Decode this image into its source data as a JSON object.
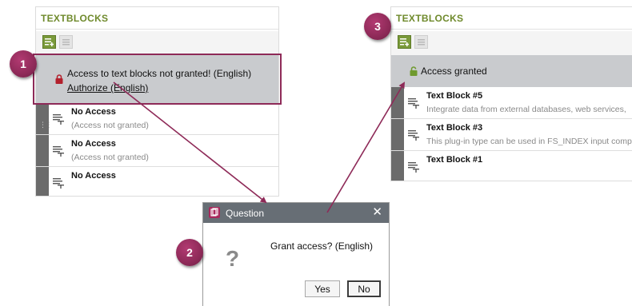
{
  "left_panel": {
    "title": "TEXTBLOCKS",
    "notice_text": "Access to text blocks not granted! (English)",
    "notice_link": "Authorize (English)",
    "items": [
      {
        "title": "No Access",
        "subtitle": "(Access not granted)"
      },
      {
        "title": "No Access",
        "subtitle": "(Access not granted)"
      },
      {
        "title": "No Access",
        "subtitle": ""
      }
    ]
  },
  "right_panel": {
    "title": "TEXTBLOCKS",
    "notice_text": "Access granted",
    "items": [
      {
        "title": "Text Block #5",
        "subtitle": "Integrate data from external databases, web services,"
      },
      {
        "title": "Text Block #3",
        "subtitle": "This plug-in type can be used in FS_INDEX input compo"
      },
      {
        "title": "Text Block #1",
        "subtitle": ""
      }
    ]
  },
  "dialog": {
    "title": "Question",
    "message": "Grant access? (English)",
    "yes_label": "Yes",
    "no_label": "No",
    "icon": "question-icon"
  },
  "steps": [
    "1",
    "2",
    "3"
  ],
  "colors": {
    "accent": "#8e2a58",
    "title_green": "#6f8a2c",
    "notice_bg": "#c9cbce",
    "lock_locked": "#b3202c",
    "lock_open": "#6f9a2e",
    "dialog_titlebar": "#676e75"
  }
}
